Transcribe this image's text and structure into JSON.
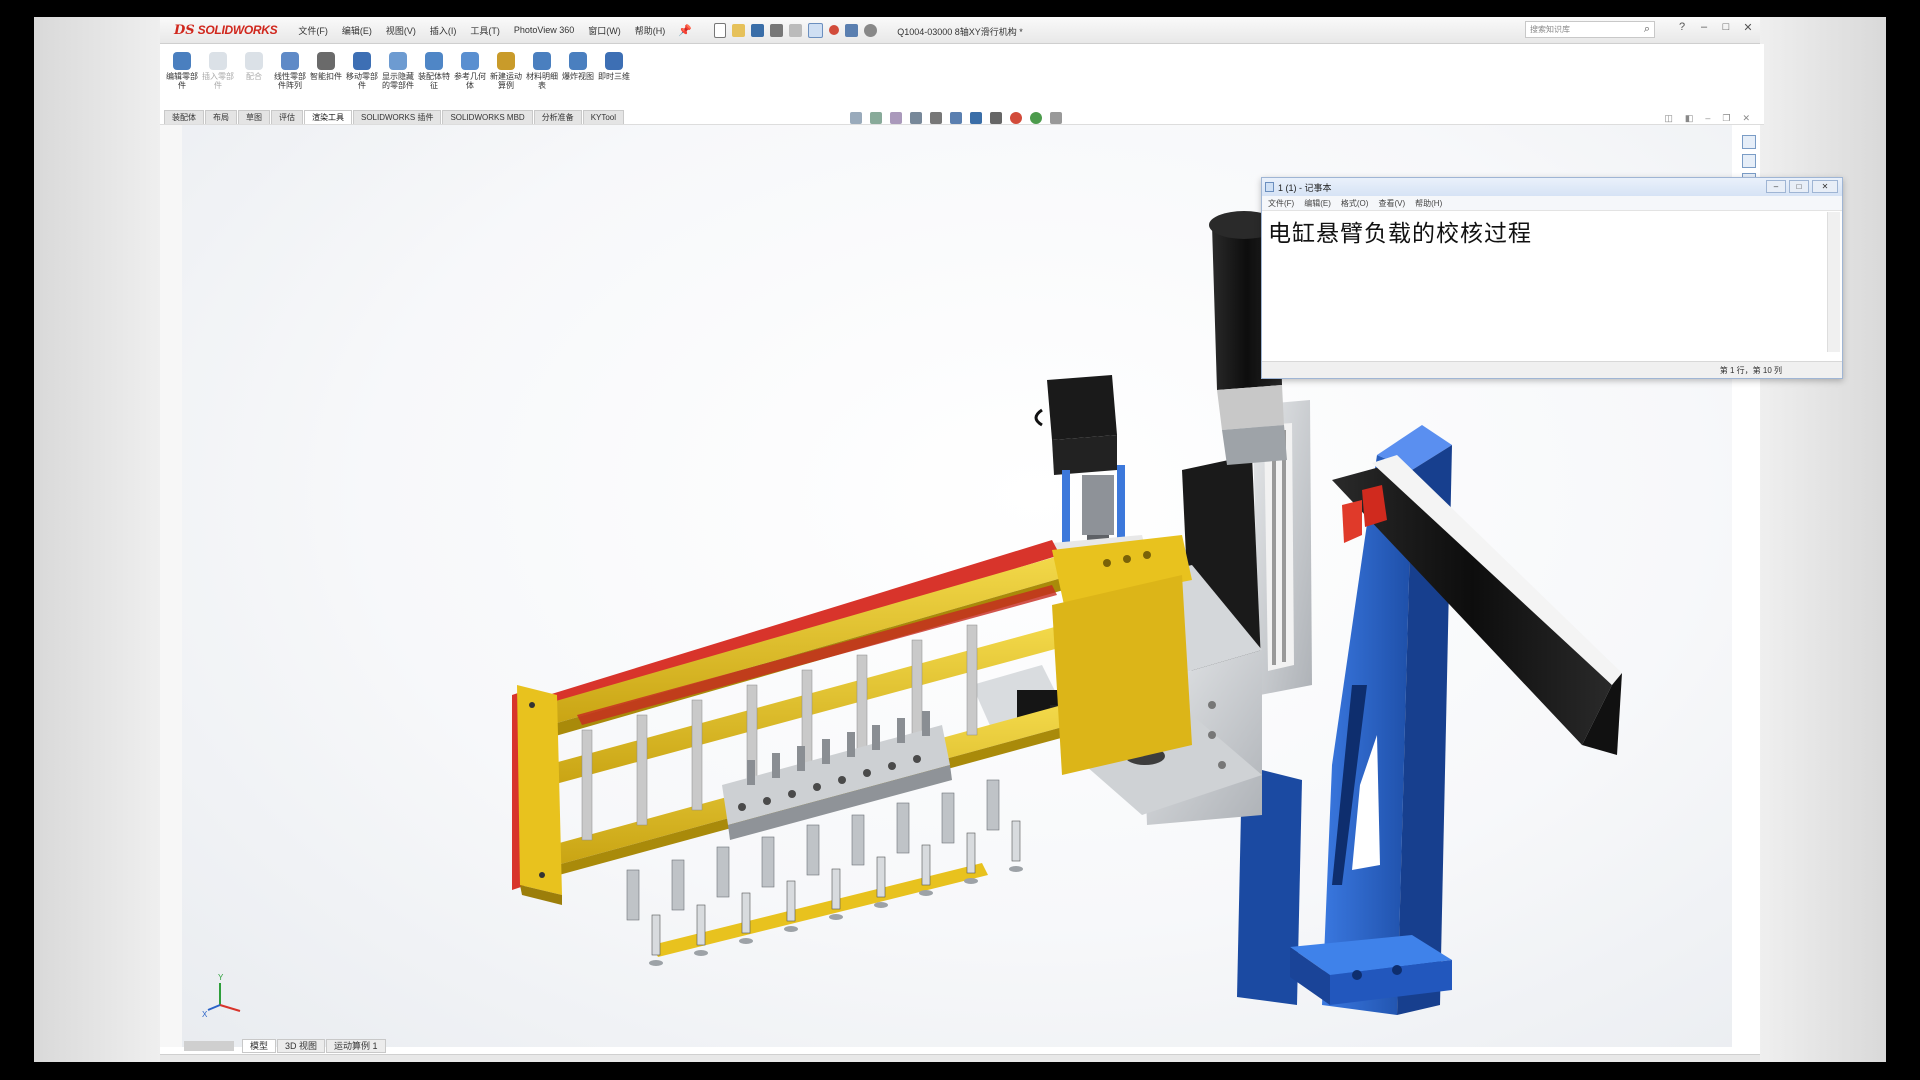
{
  "app": {
    "logo_prefix": "DS",
    "logo_name": "SOLIDWORKS",
    "document_title": "Q1004-03000 8轴XY滑行机构 *",
    "search_placeholder": "搜索知识库",
    "window_controls": [
      "?",
      "–",
      "□",
      "✕"
    ]
  },
  "menu": [
    "文件(F)",
    "编辑(E)",
    "视图(V)",
    "插入(I)",
    "工具(T)",
    "PhotoView 360",
    "窗口(W)",
    "帮助(H)"
  ],
  "commands": [
    {
      "label": "编辑零部件",
      "enabled": true,
      "color": "#4a7fbf"
    },
    {
      "label": "插入零部件",
      "enabled": false,
      "color": "#9ab"
    },
    {
      "label": "配合",
      "enabled": false,
      "color": "#9ab"
    },
    {
      "label": "线性零部件阵列",
      "enabled": true,
      "color": "#5f8ac7"
    },
    {
      "label": "智能扣件",
      "enabled": true,
      "color": "#6a6a6a"
    },
    {
      "label": "移动零部件",
      "enabled": true,
      "color": "#3d6fb4"
    },
    {
      "label": "显示隐藏的零部件",
      "enabled": true,
      "color": "#6d9bd1"
    },
    {
      "label": "装配体特征",
      "enabled": true,
      "color": "#4f86c6"
    },
    {
      "label": "参考几何体",
      "enabled": true,
      "color": "#5a8fd0"
    },
    {
      "label": "新建运动算例",
      "enabled": true,
      "color": "#c99b2a"
    },
    {
      "label": "材料明细表",
      "enabled": true,
      "color": "#4a7fbf"
    },
    {
      "label": "爆炸视图",
      "enabled": true,
      "color": "#4a7fbf"
    },
    {
      "label": "即时三维",
      "enabled": true,
      "color": "#3d6fb4"
    }
  ],
  "tabs": [
    {
      "label": "装配体",
      "active": false
    },
    {
      "label": "布局",
      "active": false
    },
    {
      "label": "草图",
      "active": false
    },
    {
      "label": "评估",
      "active": false
    },
    {
      "label": "渲染工具",
      "active": true
    },
    {
      "label": "SOLIDWORKS 插件",
      "active": false
    },
    {
      "label": "SOLIDWORKS MBD",
      "active": false
    },
    {
      "label": "分析准备",
      "active": false
    },
    {
      "label": "KYTool",
      "active": false
    }
  ],
  "notepad": {
    "title": "1 (1) - 记事本",
    "menu": [
      "文件(F)",
      "编辑(E)",
      "格式(O)",
      "查看(V)",
      "帮助(H)"
    ],
    "text": "电缸悬臂负载的校核过程",
    "status": "第 1 行，第 10 列",
    "controls": [
      "–",
      "□",
      "✕"
    ]
  },
  "bottom_tabs": [
    {
      "label": "模型",
      "active": true
    },
    {
      "label": "3D 视图",
      "active": false
    },
    {
      "label": "运动算例 1",
      "active": false
    }
  ],
  "colors": {
    "frame_yellow": "#e8c21e",
    "frame_red": "#d8342b",
    "stand_blue": "#2a63c8",
    "motor_black": "#151515",
    "steel_gray": "#c9ccd0",
    "brand_red": "#d0271d"
  },
  "triad_labels": {
    "x": "X",
    "y": "Y"
  }
}
